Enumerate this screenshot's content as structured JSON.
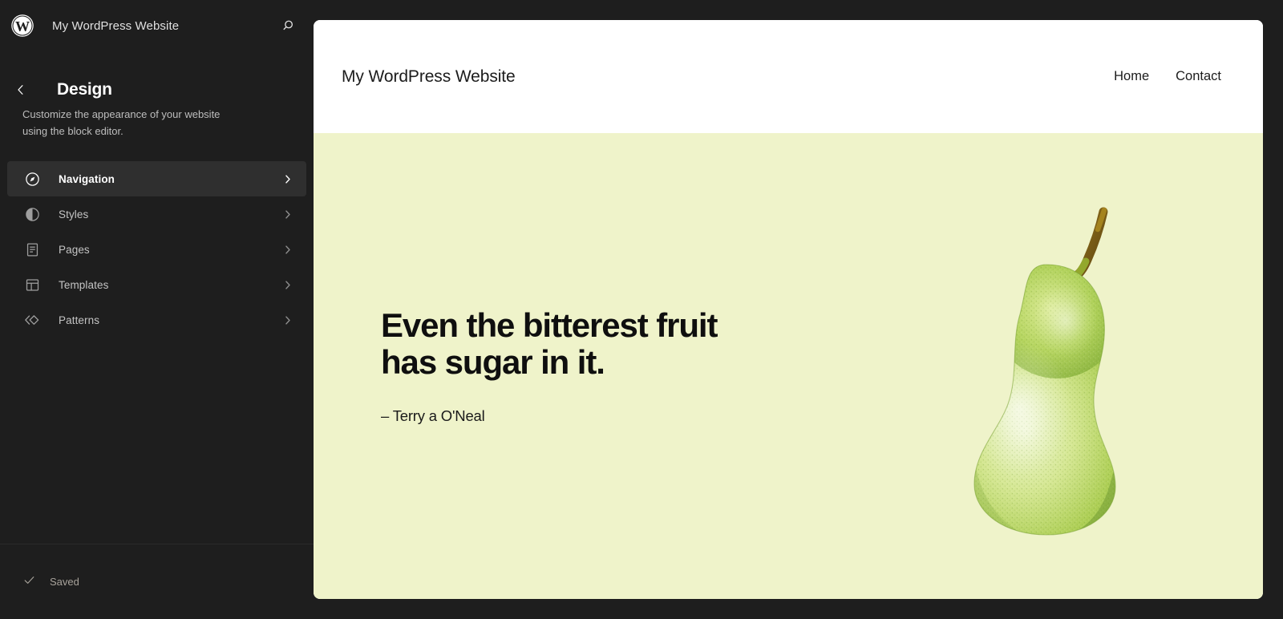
{
  "sidebar": {
    "logo_icon": "wordpress-logo-icon",
    "site_name": "My WordPress Website",
    "search_icon": "search-icon",
    "back_icon": "chevron-left-icon",
    "page_title": "Design",
    "description": "Customize the appearance of your website using the block editor.",
    "menu": [
      {
        "label": "Navigation",
        "icon": "compass-icon",
        "active": true
      },
      {
        "label": "Styles",
        "icon": "contrast-circle-icon",
        "active": false
      },
      {
        "label": "Pages",
        "icon": "page-document-icon",
        "active": false
      },
      {
        "label": "Templates",
        "icon": "layout-template-icon",
        "active": false
      },
      {
        "label": "Patterns",
        "icon": "patterns-diamond-icon",
        "active": false
      }
    ],
    "chevron_icon": "chevron-right-icon",
    "footer": {
      "check_icon": "check-icon",
      "saved_label": "Saved"
    }
  },
  "canvas": {
    "site_title": "My WordPress Website",
    "nav_links": [
      {
        "label": "Home"
      },
      {
        "label": "Contact"
      }
    ],
    "hero": {
      "heading": "Even the bitterest fruit\nhas sugar in it.",
      "citation": "– Terry a O'Neal",
      "background_color": "#eff3ca",
      "image": "pear-illustration"
    }
  },
  "colors": {
    "sidebar_bg": "#1e1e1e",
    "sidebar_active_bg": "#2f2f2f",
    "canvas_bg": "#ffffff",
    "hero_bg": "#eff3ca",
    "text_muted": "#9e9e9e"
  }
}
